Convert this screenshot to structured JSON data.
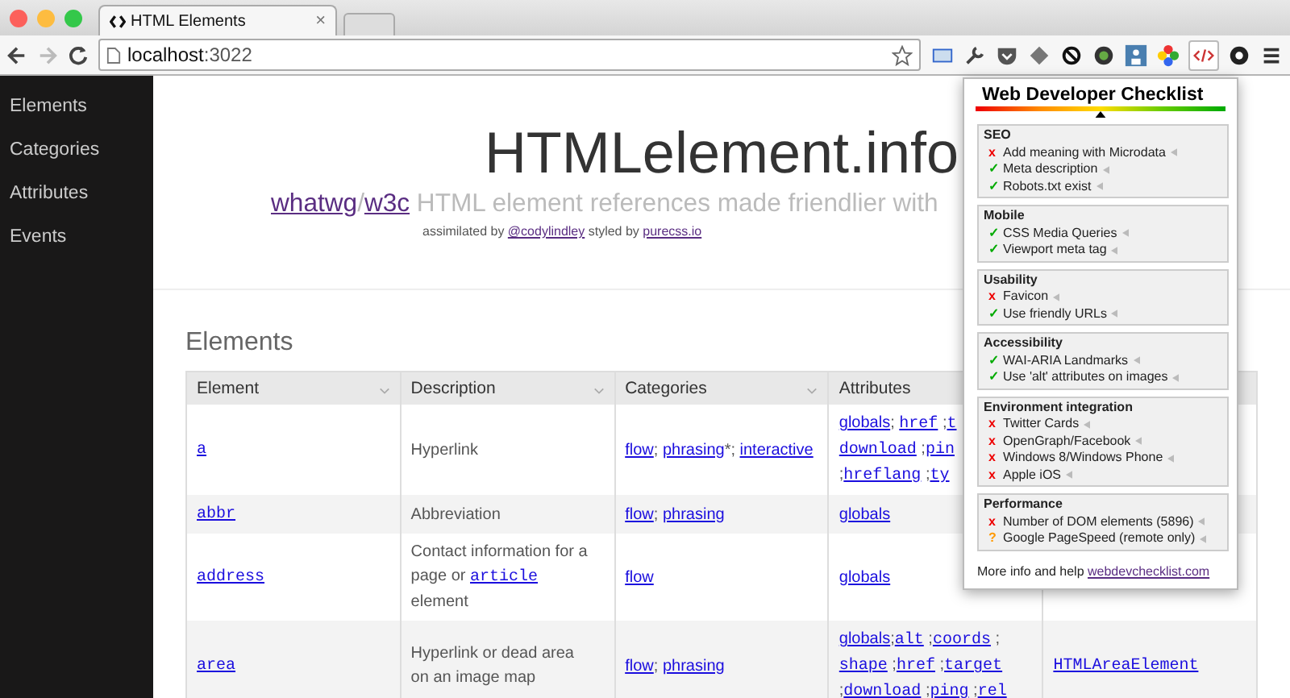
{
  "browser": {
    "tab": {
      "title": "HTML Elements",
      "close": "×"
    },
    "url": {
      "host": "localhost",
      "port": ":3022"
    }
  },
  "sidebar": {
    "items": [
      {
        "label": "Elements"
      },
      {
        "label": "Categories"
      },
      {
        "label": "Attributes"
      },
      {
        "label": "Events"
      }
    ]
  },
  "header": {
    "title": "HTMLelement.info",
    "subtitle": [
      {
        "text": "whatwg",
        "kind": "link"
      },
      {
        "text": "/",
        "kind": "plain"
      },
      {
        "text": "w3c",
        "kind": "link"
      },
      {
        "text": " HTML element references made friendlier with",
        "kind": "plain"
      }
    ],
    "credits": [
      {
        "text": "assimilated by ",
        "kind": "plain"
      },
      {
        "text": "@codylindley",
        "kind": "link"
      },
      {
        "text": " styled by ",
        "kind": "plain"
      },
      {
        "text": "purecss.io",
        "kind": "link"
      }
    ]
  },
  "section_title": "Elements",
  "table": {
    "columns": [
      "Element",
      "Description",
      "Categories",
      "Attributes"
    ],
    "rows": [
      {
        "element": "a",
        "description": [
          {
            "text": "Hyperlink",
            "kind": "plain"
          }
        ],
        "categories": [
          {
            "text": "flow",
            "kind": "link"
          },
          {
            "text": "; ",
            "kind": "plain"
          },
          {
            "text": "phrasing",
            "kind": "link"
          },
          {
            "text": "*; ",
            "kind": "plain"
          },
          {
            "text": "interactive",
            "kind": "link"
          }
        ],
        "attributes": [
          [
            {
              "text": "globals",
              "kind": "link"
            },
            {
              "text": "; ",
              "kind": "plain"
            },
            {
              "text": "href",
              "kind": "code"
            },
            {
              "text": " ;",
              "kind": "plain"
            },
            {
              "text": "t",
              "kind": "code"
            }
          ],
          [
            {
              "text": "download",
              "kind": "code"
            },
            {
              "text": " ;",
              "kind": "plain"
            },
            {
              "text": "pin",
              "kind": "code"
            }
          ],
          [
            {
              "text": ";",
              "kind": "plain"
            },
            {
              "text": "hreflang",
              "kind": "code"
            },
            {
              "text": " ;",
              "kind": "plain"
            },
            {
              "text": "ty",
              "kind": "code"
            }
          ]
        ],
        "interface": ""
      },
      {
        "element": "abbr",
        "description": [
          {
            "text": "Abbreviation",
            "kind": "plain"
          }
        ],
        "categories": [
          {
            "text": "flow",
            "kind": "link"
          },
          {
            "text": "; ",
            "kind": "plain"
          },
          {
            "text": "phrasing",
            "kind": "link"
          }
        ],
        "attributes": [
          [
            {
              "text": "globals",
              "kind": "link"
            }
          ]
        ],
        "interface": ""
      },
      {
        "element": "address",
        "description": [
          {
            "text": "Contact information for a page or ",
            "kind": "plain"
          },
          {
            "text": "article",
            "kind": "code"
          },
          {
            "text": " element",
            "kind": "plain"
          }
        ],
        "categories": [
          {
            "text": "flow",
            "kind": "link"
          }
        ],
        "attributes": [
          [
            {
              "text": "globals",
              "kind": "link"
            }
          ]
        ],
        "interface": ""
      },
      {
        "element": "area",
        "description": [
          {
            "text": "Hyperlink or dead area on an image map",
            "kind": "plain"
          }
        ],
        "categories": [
          {
            "text": "flow",
            "kind": "link"
          },
          {
            "text": "; ",
            "kind": "plain"
          },
          {
            "text": "phrasing",
            "kind": "link"
          }
        ],
        "attributes": [
          [
            {
              "text": "globals",
              "kind": "link"
            },
            {
              "text": ";",
              "kind": "plain"
            },
            {
              "text": "alt",
              "kind": "code"
            },
            {
              "text": " ;",
              "kind": "plain"
            },
            {
              "text": "coords",
              "kind": "code"
            },
            {
              "text": " ;",
              "kind": "plain"
            }
          ],
          [
            {
              "text": "shape",
              "kind": "code"
            },
            {
              "text": " ;",
              "kind": "plain"
            },
            {
              "text": "href",
              "kind": "code"
            },
            {
              "text": " ;",
              "kind": "plain"
            },
            {
              "text": "target",
              "kind": "code"
            }
          ],
          [
            {
              "text": ";",
              "kind": "plain"
            },
            {
              "text": "download",
              "kind": "code"
            },
            {
              "text": " ;",
              "kind": "plain"
            },
            {
              "text": "ping",
              "kind": "code"
            },
            {
              "text": " ;",
              "kind": "plain"
            },
            {
              "text": "rel",
              "kind": "code"
            }
          ]
        ],
        "interface": "HTMLAreaElement"
      }
    ]
  },
  "checklist": {
    "title": "Web Developer Checklist",
    "sections": [
      {
        "name": "SEO",
        "items": [
          {
            "mark": "x",
            "label": "Add meaning with Microdata",
            "kind": "fail"
          },
          {
            "mark": "✓",
            "label": "Meta description",
            "kind": "pass"
          },
          {
            "mark": "✓",
            "label": "Robots.txt exist",
            "kind": "pass"
          }
        ]
      },
      {
        "name": "Mobile",
        "items": [
          {
            "mark": "✓",
            "label": "CSS Media Queries",
            "kind": "pass"
          },
          {
            "mark": "✓",
            "label": "Viewport meta tag",
            "kind": "pass"
          }
        ]
      },
      {
        "name": "Usability",
        "items": [
          {
            "mark": "x",
            "label": "Favicon",
            "kind": "fail"
          },
          {
            "mark": "✓",
            "label": "Use friendly URLs",
            "kind": "pass"
          }
        ]
      },
      {
        "name": "Accessibility",
        "items": [
          {
            "mark": "✓",
            "label": "WAI-ARIA Landmarks",
            "kind": "pass"
          },
          {
            "mark": "✓",
            "label": "Use 'alt' attributes on images",
            "kind": "pass"
          }
        ]
      },
      {
        "name": "Environment integration",
        "items": [
          {
            "mark": "x",
            "label": "Twitter Cards",
            "kind": "fail"
          },
          {
            "mark": "x",
            "label": "OpenGraph/Facebook",
            "kind": "fail"
          },
          {
            "mark": "x",
            "label": "Windows 8/Windows Phone",
            "kind": "fail"
          },
          {
            "mark": "x",
            "label": "Apple iOS",
            "kind": "fail"
          }
        ]
      },
      {
        "name": "Performance",
        "items": [
          {
            "mark": "x",
            "label": "Number of DOM elements (5896)",
            "kind": "fail"
          },
          {
            "mark": "?",
            "label": "Google PageSpeed (remote only)",
            "kind": "warn"
          }
        ]
      }
    ],
    "footer": {
      "text": "More info and help ",
      "link": "webdevchecklist.com"
    }
  }
}
